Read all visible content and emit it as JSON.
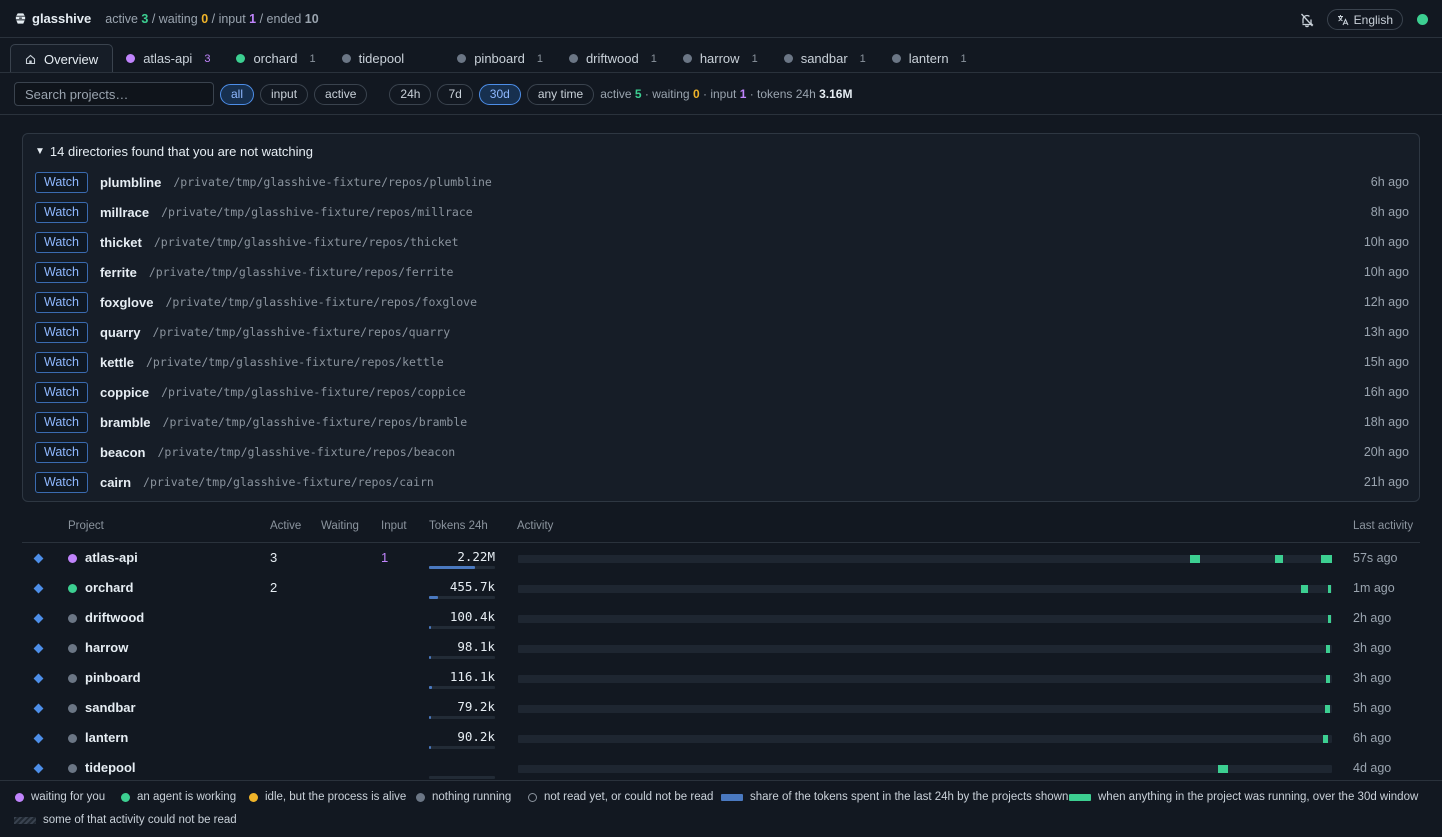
{
  "app": {
    "name": "glasshive",
    "counts": [
      {
        "label": "active",
        "value": "3",
        "sep": " / "
      },
      {
        "label": "waiting",
        "value": "0",
        "sep": " / "
      },
      {
        "label": "input",
        "value": "1",
        "sep": " / "
      },
      {
        "label": "ended",
        "value": "10",
        "sep": ""
      }
    ],
    "language": "English"
  },
  "tabs": [
    {
      "label": "Overview",
      "count": "",
      "color": ""
    },
    {
      "label": "atlas-api",
      "count": "3",
      "color": "#c084fc"
    },
    {
      "label": "orchard",
      "count": "1",
      "color": "#3ccf91"
    },
    {
      "label": "tidepool",
      "count": "",
      "color": "#6b7685"
    },
    {
      "label": "pinboard",
      "count": "1",
      "color": "#6b7685"
    },
    {
      "label": "driftwood",
      "count": "1",
      "color": "#6b7685"
    },
    {
      "label": "harrow",
      "count": "1",
      "color": "#6b7685"
    },
    {
      "label": "sandbar",
      "count": "1",
      "color": "#6b7685"
    },
    {
      "label": "lantern",
      "count": "1",
      "color": "#6b7685"
    }
  ],
  "filters": {
    "search_placeholder": "Search projects…",
    "status": [
      "all",
      "input",
      "active"
    ],
    "status_selected": "all",
    "ranges": [
      "24h",
      "7d",
      "30d",
      "any time"
    ],
    "range_selected": "30d",
    "stats": {
      "active_label": "active",
      "active": "5",
      "waiting_label": "waiting",
      "waiting": "0",
      "input_label": "input",
      "input": "1",
      "tokens_label": "tokens 24h",
      "tokens": "3.16M"
    }
  },
  "unwatched": {
    "header": "14 directories found that you are not watching",
    "watch_label": "Watch",
    "items": [
      {
        "name": "plumbline",
        "path": "/private/tmp/glasshive-fixture/repos/plumbline",
        "ago": "6h ago"
      },
      {
        "name": "millrace",
        "path": "/private/tmp/glasshive-fixture/repos/millrace",
        "ago": "8h ago"
      },
      {
        "name": "thicket",
        "path": "/private/tmp/glasshive-fixture/repos/thicket",
        "ago": "10h ago"
      },
      {
        "name": "ferrite",
        "path": "/private/tmp/glasshive-fixture/repos/ferrite",
        "ago": "10h ago"
      },
      {
        "name": "foxglove",
        "path": "/private/tmp/glasshive-fixture/repos/foxglove",
        "ago": "12h ago"
      },
      {
        "name": "quarry",
        "path": "/private/tmp/glasshive-fixture/repos/quarry",
        "ago": "13h ago"
      },
      {
        "name": "kettle",
        "path": "/private/tmp/glasshive-fixture/repos/kettle",
        "ago": "15h ago"
      },
      {
        "name": "coppice",
        "path": "/private/tmp/glasshive-fixture/repos/coppice",
        "ago": "16h ago"
      },
      {
        "name": "bramble",
        "path": "/private/tmp/glasshive-fixture/repos/bramble",
        "ago": "18h ago"
      },
      {
        "name": "beacon",
        "path": "/private/tmp/glasshive-fixture/repos/beacon",
        "ago": "20h ago"
      },
      {
        "name": "cairn",
        "path": "/private/tmp/glasshive-fixture/repos/cairn",
        "ago": "21h ago"
      }
    ]
  },
  "table": {
    "headers": {
      "project": "Project",
      "active": "Active",
      "waiting": "Waiting",
      "input": "Input",
      "tokens": "Tokens 24h",
      "activity": "Activity",
      "last": "Last activity"
    },
    "rows": [
      {
        "name": "atlas-api",
        "color": "#c084fc",
        "active": "3",
        "waiting": "",
        "input": "1",
        "tokens": "2.22M",
        "token_share": 0.7,
        "activity": [
          [
            0.826,
            0.838
          ],
          [
            0.93,
            0.94
          ],
          [
            0.986,
            1.0
          ]
        ],
        "last": "57s ago"
      },
      {
        "name": "orchard",
        "color": "#3ccf91",
        "active": "2",
        "waiting": "",
        "input": "",
        "tokens": "455.7k",
        "token_share": 0.14,
        "activity": [
          [
            0.962,
            0.97
          ],
          [
            0.995,
            0.998
          ]
        ],
        "last": "1m ago"
      },
      {
        "name": "driftwood",
        "color": "#6b7685",
        "active": "",
        "waiting": "",
        "input": "",
        "tokens": "100.4k",
        "token_share": 0.03,
        "activity": [
          [
            0.995,
            0.999
          ]
        ],
        "last": "2h ago"
      },
      {
        "name": "harrow",
        "color": "#6b7685",
        "active": "",
        "waiting": "",
        "input": "",
        "tokens": "98.1k",
        "token_share": 0.03,
        "activity": [
          [
            0.993,
            0.998
          ]
        ],
        "last": "3h ago"
      },
      {
        "name": "pinboard",
        "color": "#6b7685",
        "active": "",
        "waiting": "",
        "input": "",
        "tokens": "116.1k",
        "token_share": 0.04,
        "activity": [
          [
            0.993,
            0.998
          ]
        ],
        "last": "3h ago"
      },
      {
        "name": "sandbar",
        "color": "#6b7685",
        "active": "",
        "waiting": "",
        "input": "",
        "tokens": "79.2k",
        "token_share": 0.025,
        "activity": [
          [
            0.991,
            0.997
          ]
        ],
        "last": "5h ago"
      },
      {
        "name": "lantern",
        "color": "#6b7685",
        "active": "",
        "waiting": "",
        "input": "",
        "tokens": "90.2k",
        "token_share": 0.03,
        "activity": [
          [
            0.989,
            0.995
          ]
        ],
        "last": "6h ago"
      },
      {
        "name": "tidepool",
        "color": "#6b7685",
        "active": "",
        "waiting": "",
        "input": "",
        "tokens": "",
        "token_share": 0,
        "activity": [
          [
            0.86,
            0.872
          ]
        ],
        "last": "4d ago"
      }
    ]
  },
  "legend": [
    {
      "kind": "dot",
      "color": "#c084fc",
      "label": "waiting for you"
    },
    {
      "kind": "dot",
      "color": "#3ccf91",
      "label": "an agent is working"
    },
    {
      "kind": "dot",
      "color": "#f0b429",
      "label": "idle, but the process is alive"
    },
    {
      "kind": "dot",
      "color": "#6b7685",
      "label": "nothing running"
    },
    {
      "kind": "hollow",
      "color": "",
      "label": "not read yet, or could not be read"
    },
    {
      "kind": "bar",
      "color": "#4a79c0",
      "label": "share of the tokens spent in the last 24h by the projects shown"
    },
    {
      "kind": "bar",
      "color": "#3ccf91",
      "label": "when anything in the project was running, over the 30d window"
    },
    {
      "kind": "hatch",
      "color": "",
      "label": "some of that activity could not be read"
    }
  ]
}
